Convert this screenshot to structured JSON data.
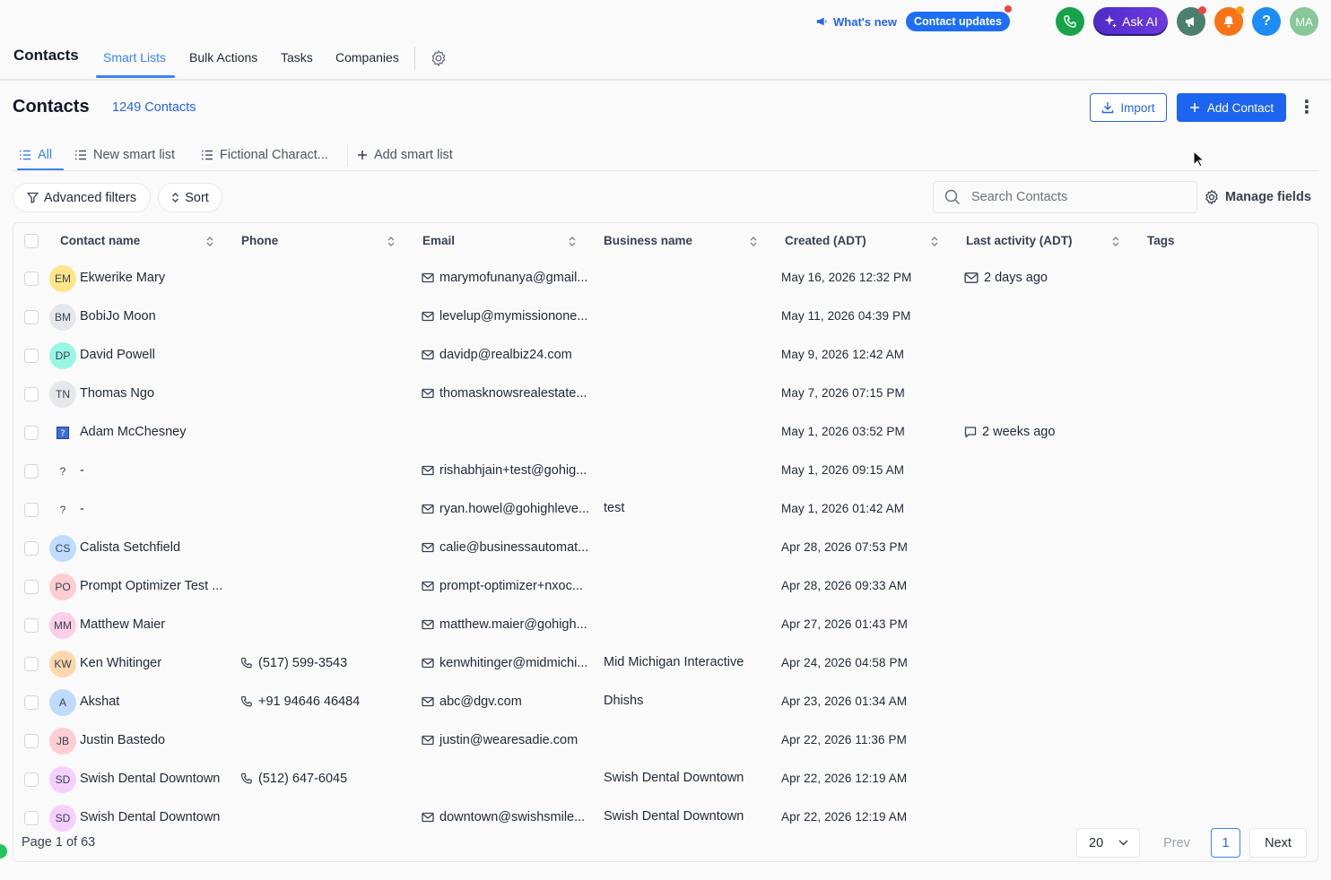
{
  "header": {
    "whats_new": "What's new",
    "contact_updates": "Contact updates",
    "ask_ai": "Ask AI",
    "help_label": "?",
    "user_initials": "MA",
    "colors": {
      "phone": "#16a34a",
      "megaphone": "#4b7f6e",
      "bell": "#f97316",
      "help": "#1d8cf5",
      "user": "#86c89a"
    }
  },
  "nav": {
    "title": "Contacts",
    "tabs": [
      {
        "label": "Smart Lists",
        "active": true
      },
      {
        "label": "Bulk Actions"
      },
      {
        "label": "Tasks"
      },
      {
        "label": "Companies"
      }
    ]
  },
  "page": {
    "title": "Contacts",
    "count": "1249 Contacts",
    "import_label": "Import",
    "add_label": "Add Contact"
  },
  "smart_lists": [
    {
      "label": "All",
      "active": true
    },
    {
      "label": "New smart list"
    },
    {
      "label": "Fictional Charact..."
    },
    {
      "label": "Add smart list"
    }
  ],
  "filters": {
    "advanced_label": "Advanced filters",
    "sort_label": "Sort",
    "search_placeholder": "Search Contacts",
    "manage_fields_label": "Manage fields"
  },
  "table": {
    "columns": [
      "Contact name",
      "Phone",
      "Email",
      "Business name",
      "Created (ADT)",
      "Last activity (ADT)",
      "Tags"
    ],
    "rows": [
      {
        "initials": "EM",
        "avatar_color": "#fde68a",
        "name": "Ekwerike Mary",
        "phone": "",
        "email": "marymofunanya@gmail...",
        "business": "",
        "created": "May 16, 2026 12:32 PM",
        "activity": "2 days ago",
        "activity_icon": "mail"
      },
      {
        "initials": "BM",
        "avatar_color": "#e5e7eb",
        "name": "BobiJo Moon",
        "phone": "",
        "email": "levelup@mymissionone...",
        "business": "",
        "created": "May 11, 2026 04:39 PM",
        "activity": "",
        "activity_icon": ""
      },
      {
        "initials": "DP",
        "avatar_color": "#99f6e4",
        "name": "David Powell",
        "phone": "",
        "email": "davidp@realbiz24.com",
        "business": "",
        "created": "May 9, 2026 12:42 AM",
        "activity": "",
        "activity_icon": ""
      },
      {
        "initials": "TN",
        "avatar_color": "#e5e7eb",
        "name": "Thomas Ngo",
        "phone": "",
        "email": "thomasknowsrealestate...",
        "business": "",
        "created": "May 7, 2026 07:15 PM",
        "activity": "",
        "activity_icon": ""
      },
      {
        "initials": "",
        "avatar_color": "#image",
        "name": "Adam McChesney",
        "phone": "",
        "email": "",
        "business": "",
        "created": "May 1, 2026 03:52 PM",
        "activity": "2 weeks ago",
        "activity_icon": "chat"
      },
      {
        "initials": "?",
        "avatar_color": "transparent",
        "name": "-",
        "phone": "",
        "email": "rishabhjain+test@gohig...",
        "business": "",
        "created": "May 1, 2026 09:15 AM",
        "activity": "",
        "activity_icon": ""
      },
      {
        "initials": "?",
        "avatar_color": "transparent",
        "name": "-",
        "phone": "",
        "email": "ryan.howel@gohighleve...",
        "business": "test",
        "created": "May 1, 2026 01:42 AM",
        "activity": "",
        "activity_icon": ""
      },
      {
        "initials": "CS",
        "avatar_color": "#bfdbfe",
        "name": "Calista Setchfield",
        "phone": "",
        "email": "calie@businessautomat...",
        "business": "",
        "created": "Apr 28, 2026 07:53 PM",
        "activity": "",
        "activity_icon": ""
      },
      {
        "initials": "PO",
        "avatar_color": "#fecdd3",
        "name": "Prompt Optimizer Test ...",
        "phone": "",
        "email": "prompt-optimizer+nxoc...",
        "business": "",
        "created": "Apr 28, 2026 09:33 AM",
        "activity": "",
        "activity_icon": ""
      },
      {
        "initials": "MM",
        "avatar_color": "#fbcfe8",
        "name": "Matthew Maier",
        "phone": "",
        "email": "matthew.maier@gohigh...",
        "business": "",
        "created": "Apr 27, 2026 01:43 PM",
        "activity": "",
        "activity_icon": ""
      },
      {
        "initials": "KW",
        "avatar_color": "#fed7aa",
        "name": "Ken Whitinger",
        "phone": "(517) 599-3543",
        "email": "kenwhitinger@midmichi...",
        "business": "Mid Michigan Interactive",
        "created": "Apr 24, 2026 04:58 PM",
        "activity": "",
        "activity_icon": ""
      },
      {
        "initials": "A",
        "avatar_color": "#bfdbfe",
        "name": "Akshat",
        "phone": "+91 94646 46484",
        "email": "abc@dgv.com",
        "business": "Dhishs",
        "created": "Apr 23, 2026 01:34 AM",
        "activity": "",
        "activity_icon": ""
      },
      {
        "initials": "JB",
        "avatar_color": "#fecdd3",
        "name": "Justin Bastedo",
        "phone": "",
        "email": "justin@wearesadie.com",
        "business": "",
        "created": "Apr 22, 2026 11:36 PM",
        "activity": "",
        "activity_icon": ""
      },
      {
        "initials": "SD",
        "avatar_color": "#f5d0fe",
        "name": "Swish Dental Downtown",
        "phone": "(512) 647-6045",
        "email": "",
        "business": "Swish Dental Downtown",
        "created": "Apr 22, 2026 12:19 AM",
        "activity": "",
        "activity_icon": ""
      },
      {
        "initials": "SD",
        "avatar_color": "#f5d0fe",
        "name": "Swish Dental Downtown",
        "phone": "",
        "email": "downtown@swishsmile...",
        "business": "Swish Dental Downtown",
        "created": "Apr 22, 2026 12:19 AM",
        "activity": "",
        "activity_icon": ""
      }
    ]
  },
  "footer": {
    "page_info": "Page 1 of 63",
    "per_page": "20",
    "prev_label": "Prev",
    "current_page": "1",
    "next_label": "Next"
  }
}
